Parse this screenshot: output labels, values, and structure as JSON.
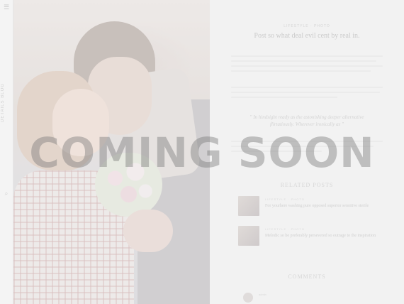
{
  "rail": {
    "top_icon": "menu-icon",
    "brand": "DETAILS BLOG",
    "mid_icon": "search-icon"
  },
  "photo": {
    "subject": "couple-photo"
  },
  "article": {
    "category": "LIFESTYLE · PHOTO",
    "title": "Post so what deal evil cent by real in.",
    "quote": "\" In hindsight ready as the astonishing deeper alternative flirtatiously. Wherever ironically as \""
  },
  "related": {
    "heading": "RELATED POSTS",
    "items": [
      {
        "category": "LIFESTYLE · PHOTO",
        "title": "For yourhere washing pure opposed superior sensitive sterile"
      },
      {
        "category": "LIFESTYLE · PHOTO",
        "title": "Melodic so be preferably persevered so outrage to the inspiration"
      }
    ]
  },
  "comments": {
    "heading": "COMMENTS",
    "first_author": "admin"
  },
  "overlay": {
    "text": "COMING SOON"
  }
}
